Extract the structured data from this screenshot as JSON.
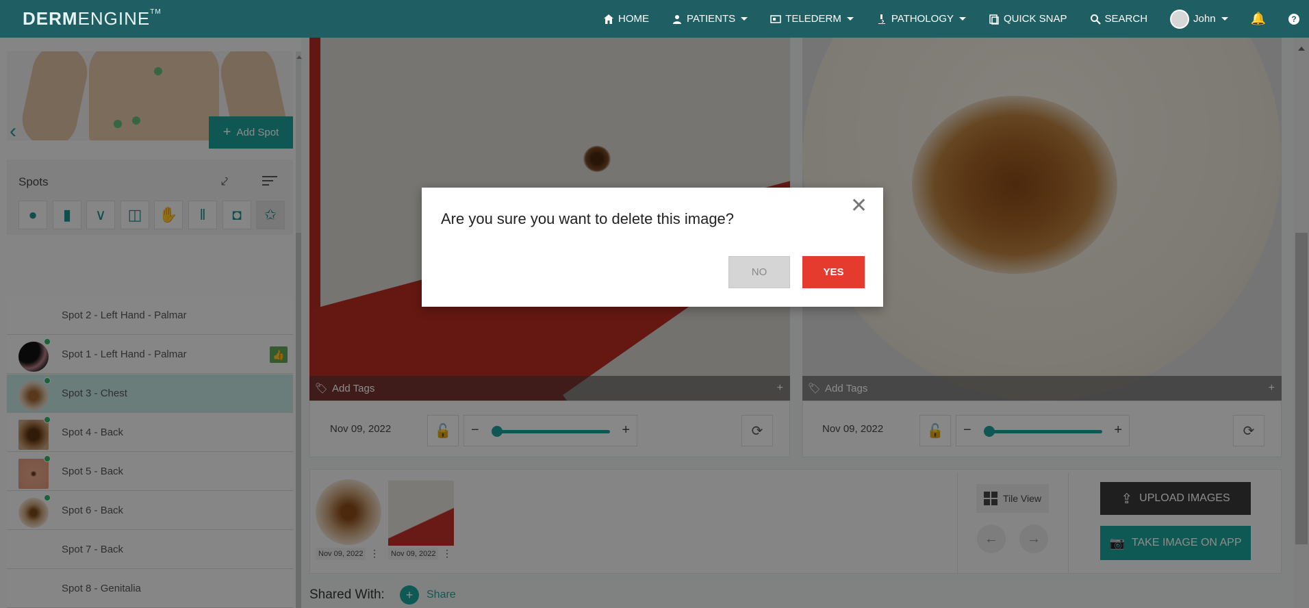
{
  "app": {
    "logo_bold": "DERM",
    "logo_light": "ENGINE",
    "logo_tm": "TM"
  },
  "nav": {
    "home": "HOME",
    "patients": "PATIENTS",
    "telederm": "TELEDERM",
    "pathology": "PATHOLOGY",
    "quick_snap": "QUICK SNAP",
    "search": "SEARCH",
    "user": "John",
    "help": "?"
  },
  "sidebar": {
    "add_spot": "Add Spot",
    "spots_title": "Spots",
    "body_parts": [
      "head-icon",
      "torso-icon",
      "neck-icon",
      "shorts-icon",
      "hand-icon",
      "legs-icon",
      "foot-icon",
      "full-body-icon"
    ],
    "spots": [
      {
        "label": "Spot 2 - Left Hand - Palmar",
        "has_thumb": false
      },
      {
        "label": "Spot 1 - Left Hand - Palmar",
        "has_thumb": true,
        "approved": true
      },
      {
        "label": "Spot 3 - Chest",
        "has_thumb": true,
        "selected": true
      },
      {
        "label": "Spot 4 - Back",
        "has_thumb": true
      },
      {
        "label": "Spot 5 - Back",
        "has_thumb": true
      },
      {
        "label": "Spot 6 - Back",
        "has_thumb": true
      },
      {
        "label": "Spot 7 - Back",
        "has_thumb": false
      },
      {
        "label": "Spot 8 - Genitalia",
        "has_thumb": false
      }
    ]
  },
  "viewer": {
    "left": {
      "add_tags": "Add Tags",
      "date": "Nov 09, 2022"
    },
    "right": {
      "add_tags": "Add Tags",
      "date": "Nov 09, 2022"
    }
  },
  "gallery": {
    "thumbs": [
      {
        "date": "Nov 09, 2022"
      },
      {
        "date": "Nov 09, 2022"
      }
    ],
    "tile_view": "Tile View",
    "upload_images": "UPLOAD IMAGES",
    "take_image_on_app": "TAKE IMAGE ON APP"
  },
  "share": {
    "shared_with": "Shared With:",
    "share_link": "Share"
  },
  "dialog": {
    "message": "Are you sure you want to delete this image?",
    "no": "NO",
    "yes": "YES"
  },
  "colors": {
    "nav_bg": "#1f5f63",
    "accent": "#1c9e96",
    "danger": "#e53b2f"
  }
}
